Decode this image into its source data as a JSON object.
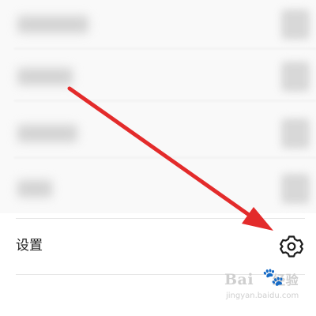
{
  "settings": {
    "label": "设置",
    "icon": "gear-icon"
  },
  "watermark": {
    "brand": "Bai",
    "paw": "🐾",
    "brand_suffix": "经验",
    "site": "jingyan.baidu.com"
  },
  "annotation": {
    "arrow_color": "#e32b2b"
  }
}
